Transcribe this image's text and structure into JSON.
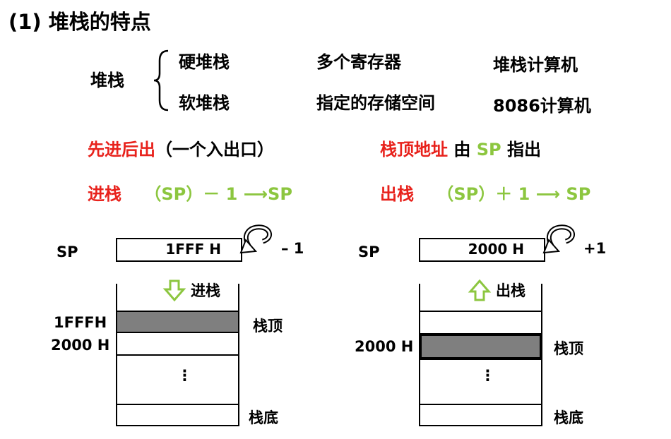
{
  "title": "(1) 堆栈的特点",
  "classification": {
    "root": "堆栈",
    "rows": [
      {
        "type": "硬堆栈",
        "desc": "多个寄存器",
        "example": "堆栈计算机"
      },
      {
        "type": "软堆栈",
        "desc": "指定的存储空间",
        "example": "8086计算机"
      }
    ]
  },
  "features": {
    "lifo": {
      "label": "先进后出",
      "note": "（一个入出口）"
    },
    "top_addr": {
      "label": "栈顶地址",
      "mid": "由",
      "reg": "SP",
      "tail": "指出"
    },
    "push": {
      "label": "进栈",
      "formula": "（SP）－ 1 ⟶SP"
    },
    "pop": {
      "label": "出栈",
      "formula": "（SP）＋ 1 ⟶ SP"
    }
  },
  "diagrams": {
    "push": {
      "sp_label": "SP",
      "sp_value": "1FFF H",
      "delta": "– 1",
      "arrow_label": "进栈",
      "addr_top": "1FFFH",
      "addr_next": "2000 H",
      "top_label": "栈顶",
      "bottom_label": "栈底",
      "ellipsis": "⋮"
    },
    "pop": {
      "sp_label": "SP",
      "sp_value": "2000 H",
      "delta": "+1",
      "arrow_label": "出栈",
      "addr_top": "2000 H",
      "top_label": "栈顶",
      "bottom_label": "栈底",
      "ellipsis": "⋮"
    }
  },
  "colors": {
    "red": "#e8221c",
    "green": "#8cc63f",
    "shade": "#7f7f7f"
  }
}
